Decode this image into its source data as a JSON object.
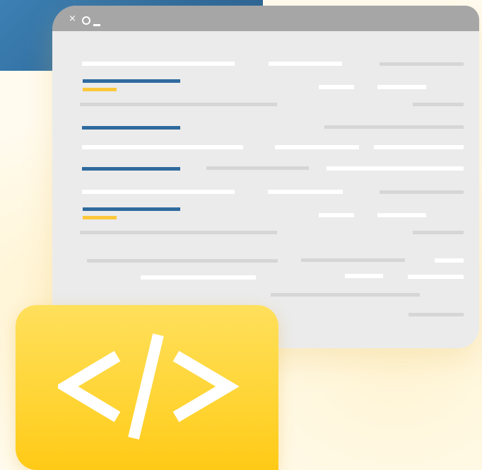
{
  "window": {
    "controls": {
      "close_glyph": "×",
      "maximize_glyph": "○",
      "minimize_glyph": "_"
    }
  },
  "code_badge": {
    "icon": "code-brackets-icon",
    "glyph": "</>"
  },
  "colors": {
    "accent_blue": "#2f6a9e",
    "accent_yellow": "#fcc83b",
    "window_body": "#ebebeb",
    "window_titlebar": "#a6a6a6",
    "badge_yellow": "#ffd433"
  }
}
